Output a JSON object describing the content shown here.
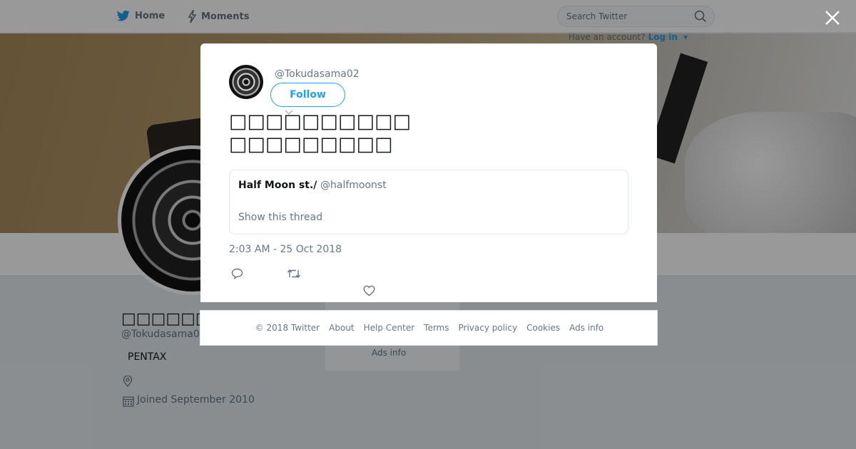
{
  "nav": {
    "home_label": "Home",
    "moments_label": "Moments",
    "search_placeholder": "Search Twitter",
    "account_prompt": "Have an account?",
    "login_label": "Log in"
  },
  "profile": {
    "name": "□□□□□□",
    "handle": "@Tokudasama02",
    "bio": "PENTAX",
    "joined": "Joined September 2010"
  },
  "sidebar": {
    "ads_info": "Ads info"
  },
  "tweet": {
    "handle": "@Tokudasama02",
    "follow_label": "Follow",
    "text_line1": "□□□□□□□□□□",
    "text_line2": "□□□□□□□□□",
    "quote": {
      "name": "Half Moon st./",
      "handle": "@halfmoonst",
      "thread_link": "Show this thread"
    },
    "timestamp": "2:03 AM - 25 Oct 2018"
  },
  "footer": {
    "links": [
      "© 2018 Twitter",
      "About",
      "Help Center",
      "Terms",
      "Privacy policy",
      "Cookies",
      "Ads info"
    ]
  },
  "colors": {
    "accent": "#1da1f2",
    "muted_text": "#657786",
    "overlay": "rgba(0,0,0,0.40)"
  },
  "icons": [
    "twitter-bird-icon",
    "lightning-icon",
    "search-icon",
    "close-icon",
    "location-icon",
    "calendar-icon",
    "reply-icon",
    "retweet-icon",
    "like-icon",
    "chevron-down-icon"
  ]
}
